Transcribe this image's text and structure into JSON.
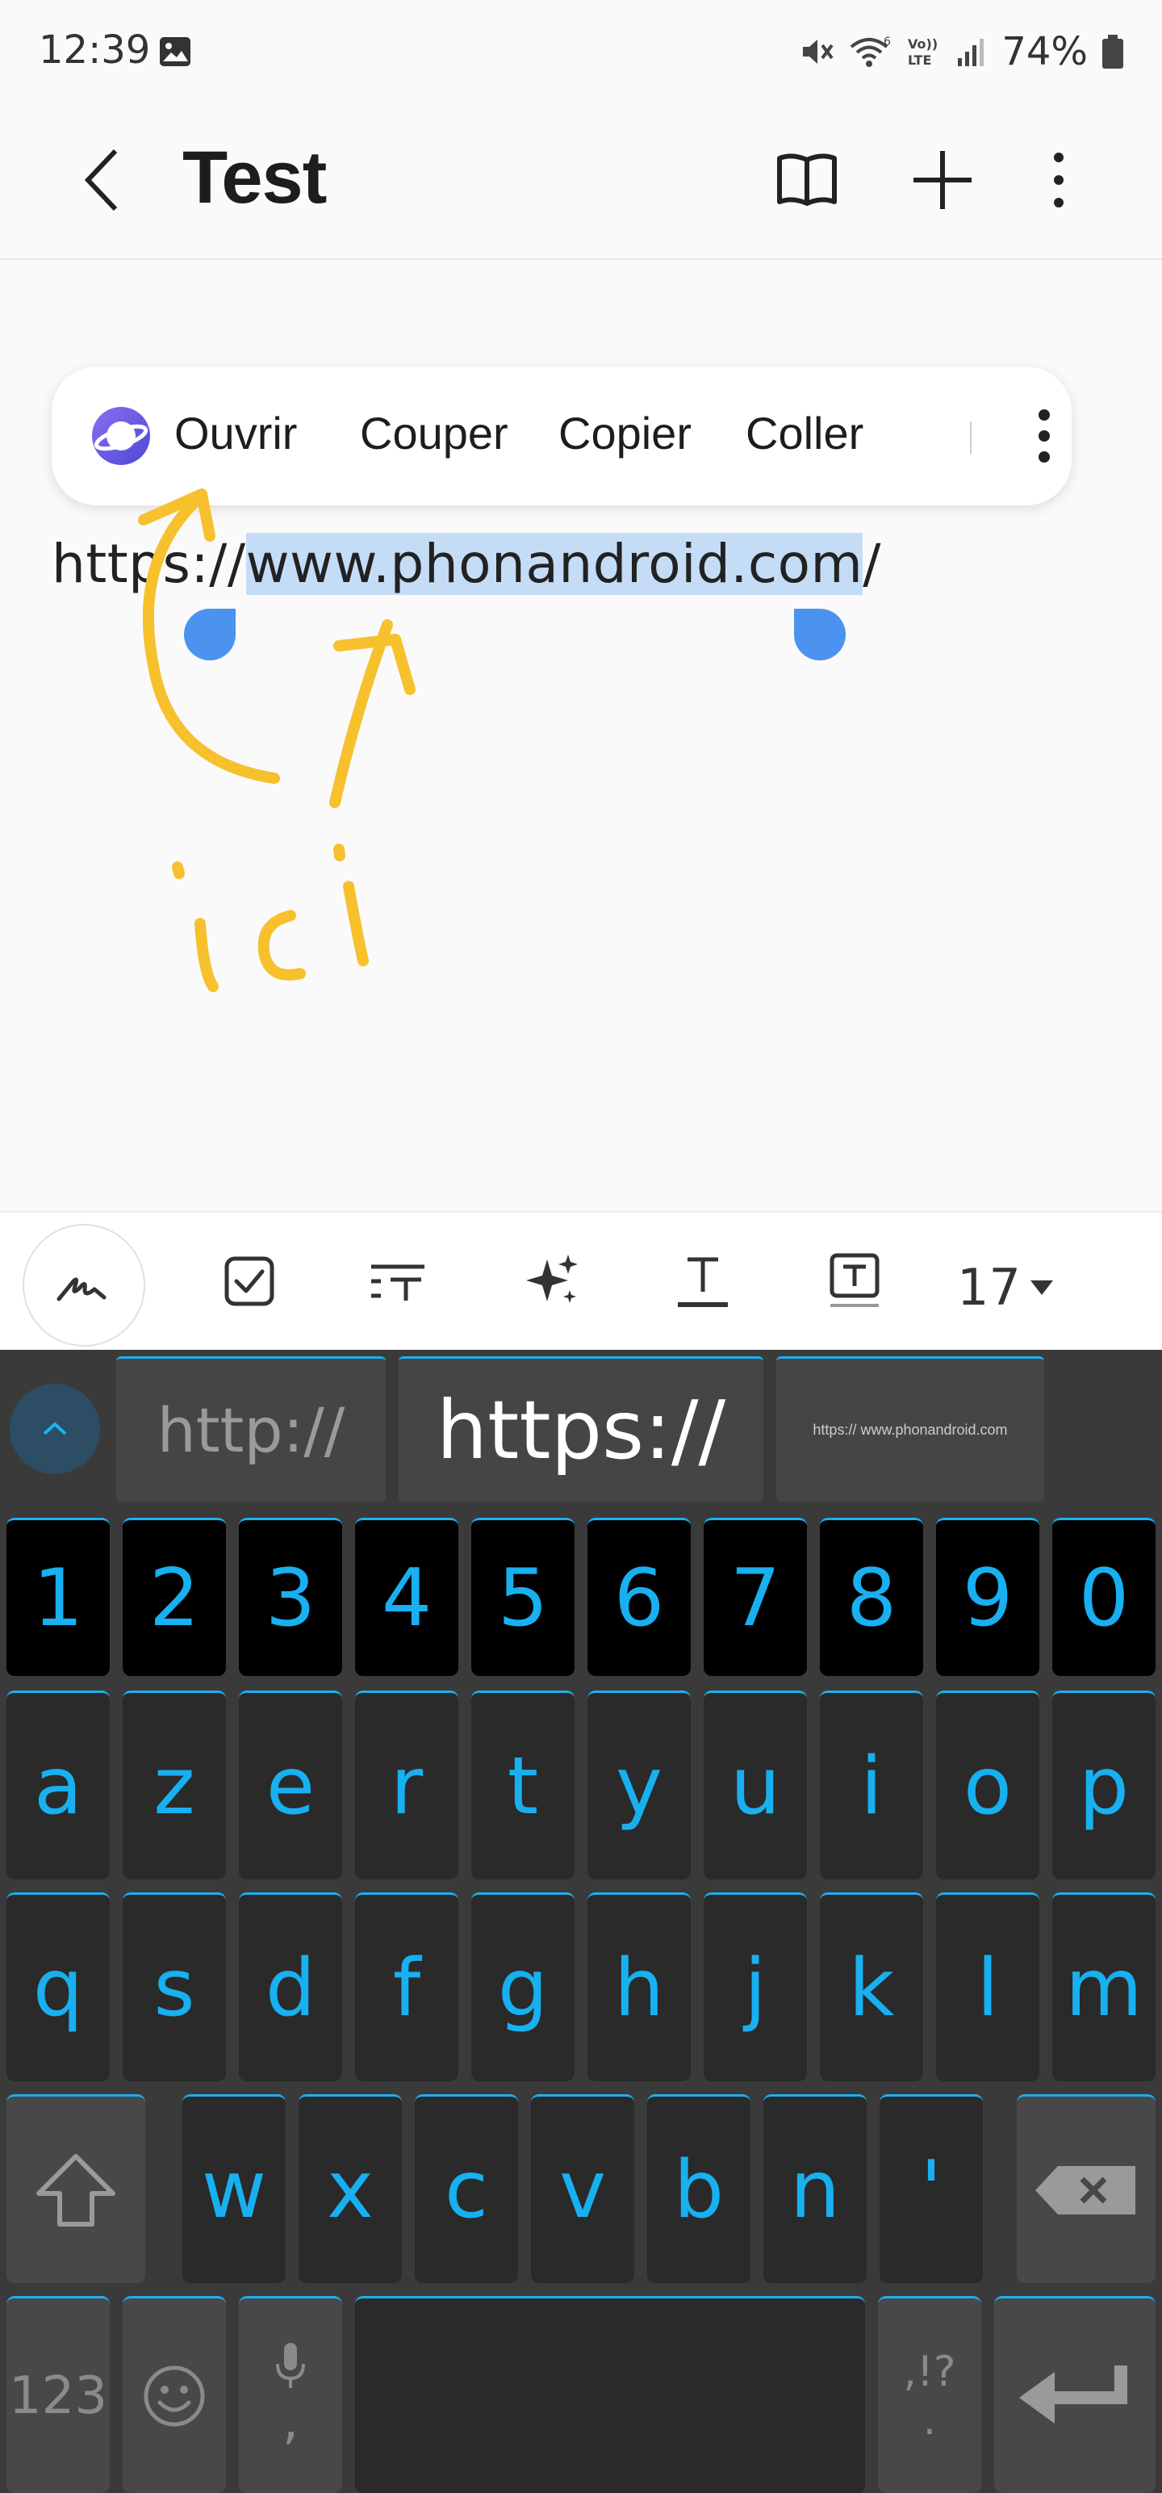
{
  "status_bar": {
    "time": "12:39",
    "battery_percent": "74%",
    "icons": [
      "gallery-icon",
      "mute-icon",
      "wifi-6-icon",
      "volte-icon",
      "signal-icon",
      "battery-icon"
    ]
  },
  "app_bar": {
    "title": "Test",
    "icons": [
      "back-icon",
      "book-icon",
      "plus-icon",
      "more-vertical-icon"
    ]
  },
  "context_menu": {
    "items": [
      "Ouvrir",
      "Couper",
      "Copier",
      "Coller"
    ],
    "icons": [
      "samsung-internet-icon",
      "more-vertical-icon"
    ]
  },
  "editor": {
    "url_prefix": "https://",
    "url_selected": "www.phonandroid.com",
    "url_suffix": "/",
    "annotation_text": "ici"
  },
  "format_toolbar": {
    "icons": [
      "handwriting-pen-icon",
      "checkbox-icon",
      "text-style-icon",
      "ai-sparkle-icon",
      "text-underline-icon",
      "text-box-icon"
    ],
    "font_size": "17"
  },
  "keyboard": {
    "suggestions": [
      "http://",
      "https://",
      "https:// www.phonandroid.com"
    ],
    "number_row": [
      "1",
      "2",
      "3",
      "4",
      "5",
      "6",
      "7",
      "8",
      "9",
      "0"
    ],
    "row1": [
      "a",
      "z",
      "e",
      "r",
      "t",
      "y",
      "u",
      "i",
      "o",
      "p"
    ],
    "row2": [
      "q",
      "s",
      "d",
      "f",
      "g",
      "h",
      "j",
      "k",
      "l",
      "m"
    ],
    "row3": [
      "w",
      "x",
      "c",
      "v",
      "b",
      "n",
      "'"
    ],
    "bottom": {
      "numbers_label": "123",
      "comma": ",",
      "punct_top": ",!?",
      "punct_bottom": "."
    },
    "colors": {
      "accent": "#1cb0f0",
      "key_bg": "#2a2a2a",
      "num_key_bg": "#000000",
      "board_bg": "#3a3a3a"
    }
  }
}
